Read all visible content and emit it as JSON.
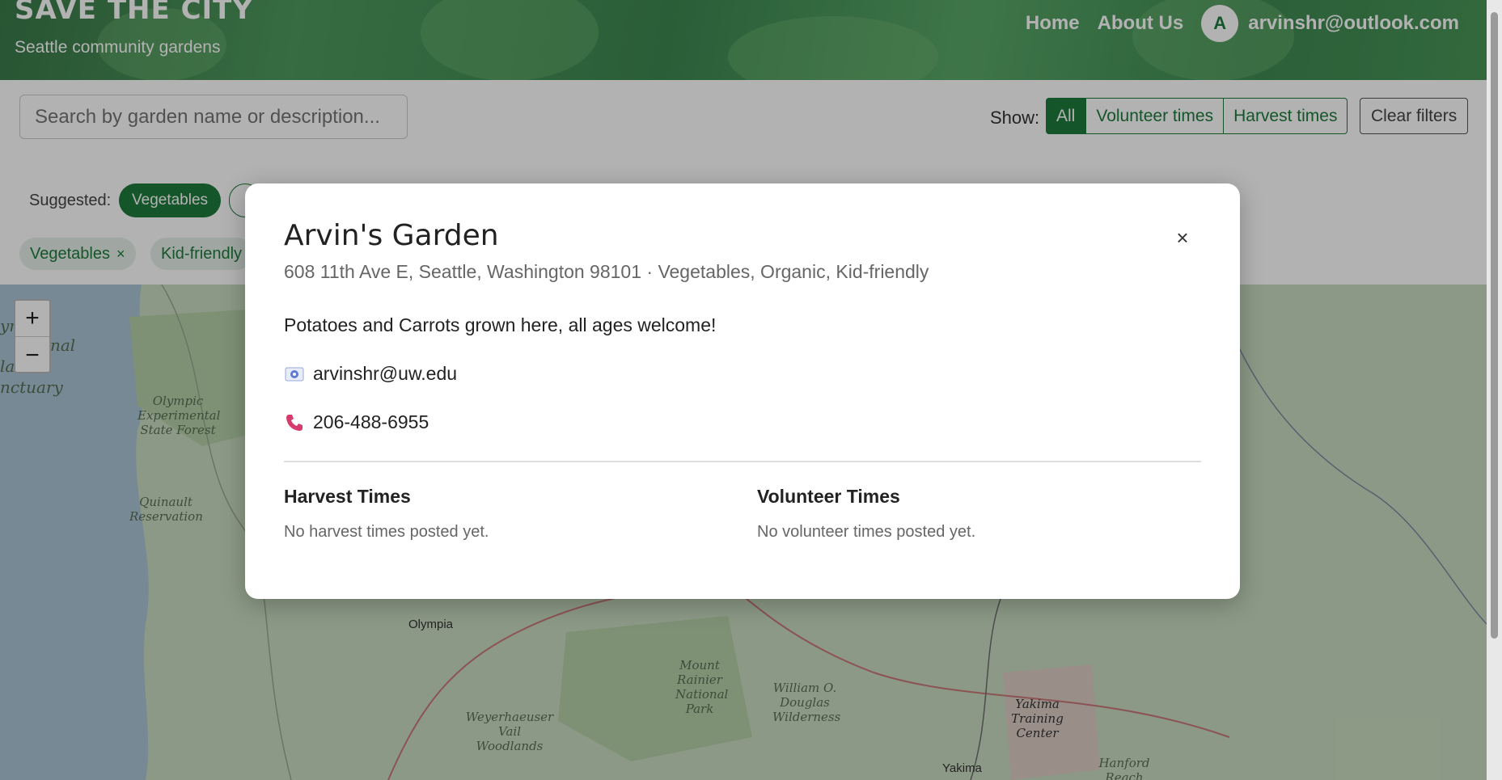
{
  "header": {
    "brand_title": "SAVE THE CITY",
    "brand_subtitle": "Seattle community gardens",
    "nav": {
      "home": "Home",
      "about": "About Us"
    },
    "user": {
      "avatar_letter": "A",
      "email": "arvinshr@outlook.com"
    }
  },
  "filters": {
    "search_placeholder": "Search by garden name or description...",
    "show_label": "Show:",
    "segments": [
      "All",
      "Volunteer times",
      "Harvest times"
    ],
    "active_segment": "All",
    "clear_label": "Clear filters",
    "suggested_label": "Suggested:",
    "suggested": [
      "Vegetables"
    ],
    "selected": [
      "Vegetables",
      "Kid-friendly"
    ],
    "chip_remove_glyph": "×"
  },
  "map": {
    "zoom_in": "+",
    "zoom_out": "−",
    "labels": {
      "olympic_forest": "Olympic Experimental State Forest",
      "quinault": "Quinault Reservation",
      "olympia": "Olympia",
      "weyerhaeuser": "Weyerhaeuser Vail Woodlands",
      "rainier": "Mount Rainier National Park",
      "douglas": "William O. Douglas Wilderness",
      "yakima_center": "Yakima Training Center",
      "yakima": "Yakima",
      "hanford": "Hanford Reach National",
      "marine_1": "ym",
      "marine_2": "nal",
      "marine_3": "larine",
      "marine_4": "nctuary"
    }
  },
  "modal": {
    "title": "Arvin's Garden",
    "close_glyph": "×",
    "address_line": "608 11th Ave E, Seattle, Washington 98101 · Vegetables, Organic, Kid-friendly",
    "description": "Potatoes and Carrots grown here, all ages welcome!",
    "email": "arvinshr@uw.edu",
    "phone": "206-488-6955",
    "harvest_title": "Harvest Times",
    "harvest_empty": "No harvest times posted yet.",
    "volunteer_title": "Volunteer Times",
    "volunteer_empty": "No volunteer times posted yet."
  },
  "colors": {
    "brand_green": "#1e7a3c",
    "phone_icon": "#d63b6b",
    "email_icon": "#5b7bd6"
  }
}
